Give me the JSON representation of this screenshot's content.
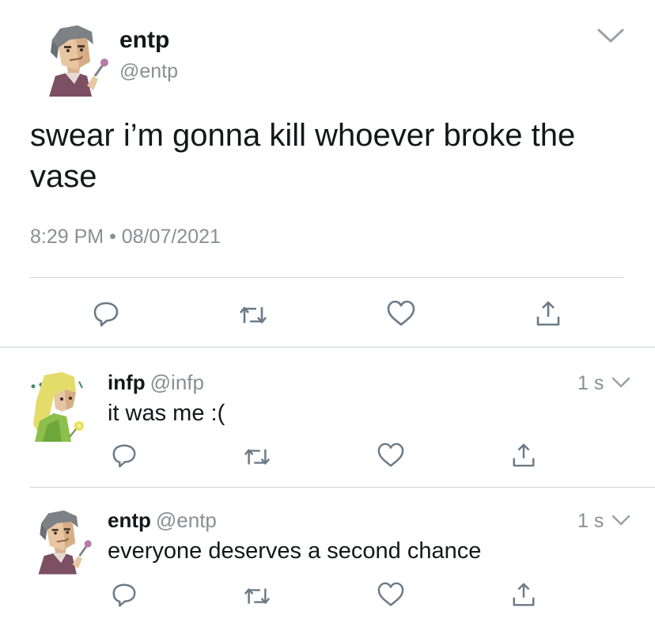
{
  "main_tweet": {
    "display_name": "entp",
    "handle": "@entp",
    "text": "swear i’m gonna kill whoever broke the vase",
    "time": "8:29 PM",
    "separator": "•",
    "date": "08/07/2021",
    "avatar_icon": "entp-character-avatar"
  },
  "replies": [
    {
      "display_name": "infp",
      "handle": "@infp",
      "text": "it was me :(",
      "age": "1 s",
      "avatar_icon": "infp-character-avatar"
    },
    {
      "display_name": "entp",
      "handle": "@entp",
      "text": "everyone deserves a second chance",
      "age": "1 s",
      "avatar_icon": "entp-character-avatar"
    }
  ],
  "action_icons": [
    "reply-icon",
    "retweet-icon",
    "like-icon",
    "share-icon"
  ],
  "colors": {
    "text": "#14171a",
    "secondary": "#8a8f94",
    "icon": "#6b7a86",
    "divider": "#d0d4d8"
  }
}
